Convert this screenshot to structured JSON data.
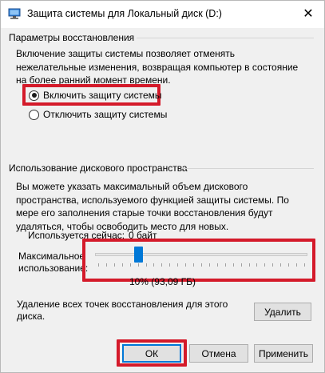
{
  "window": {
    "title": "Защита системы для Локальный диск (D:)",
    "close_glyph": "✕"
  },
  "restore_settings": {
    "heading": "Параметры восстановления",
    "description": "Включение защиты системы позволяет отменять нежелательные изменения, возвращая компьютер в состояние на более ранний момент времени.",
    "options": [
      {
        "label": "Включить защиту системы",
        "selected": true
      },
      {
        "label": "Отключить защиту системы",
        "selected": false
      }
    ]
  },
  "disk_usage": {
    "heading": "Использование дискового пространства",
    "description": "Вы можете указать максимальный объем дискового пространства, используемого функцией защиты системы. По мере его заполнения старые точки восстановления будут удаляться, чтобы освободить место для новых.",
    "current_label": "Используется сейчас:",
    "current_value": "0 байт",
    "max_label_line1": "Максимальное",
    "max_label_line2": "использование:",
    "slider_percent": 10,
    "slider_value_text": "10% (93,09 ГБ)",
    "delete_text": "Удаление всех точек восстановления для этого диска.",
    "delete_button": "Удалить"
  },
  "footer": {
    "ok": "ОК",
    "cancel": "Отмена",
    "apply": "Применить"
  },
  "colors": {
    "highlight": "#d41a2a",
    "accent": "#0078d7"
  },
  "icons": {
    "title_icon": "system-protection-icon",
    "close": "close-icon"
  }
}
